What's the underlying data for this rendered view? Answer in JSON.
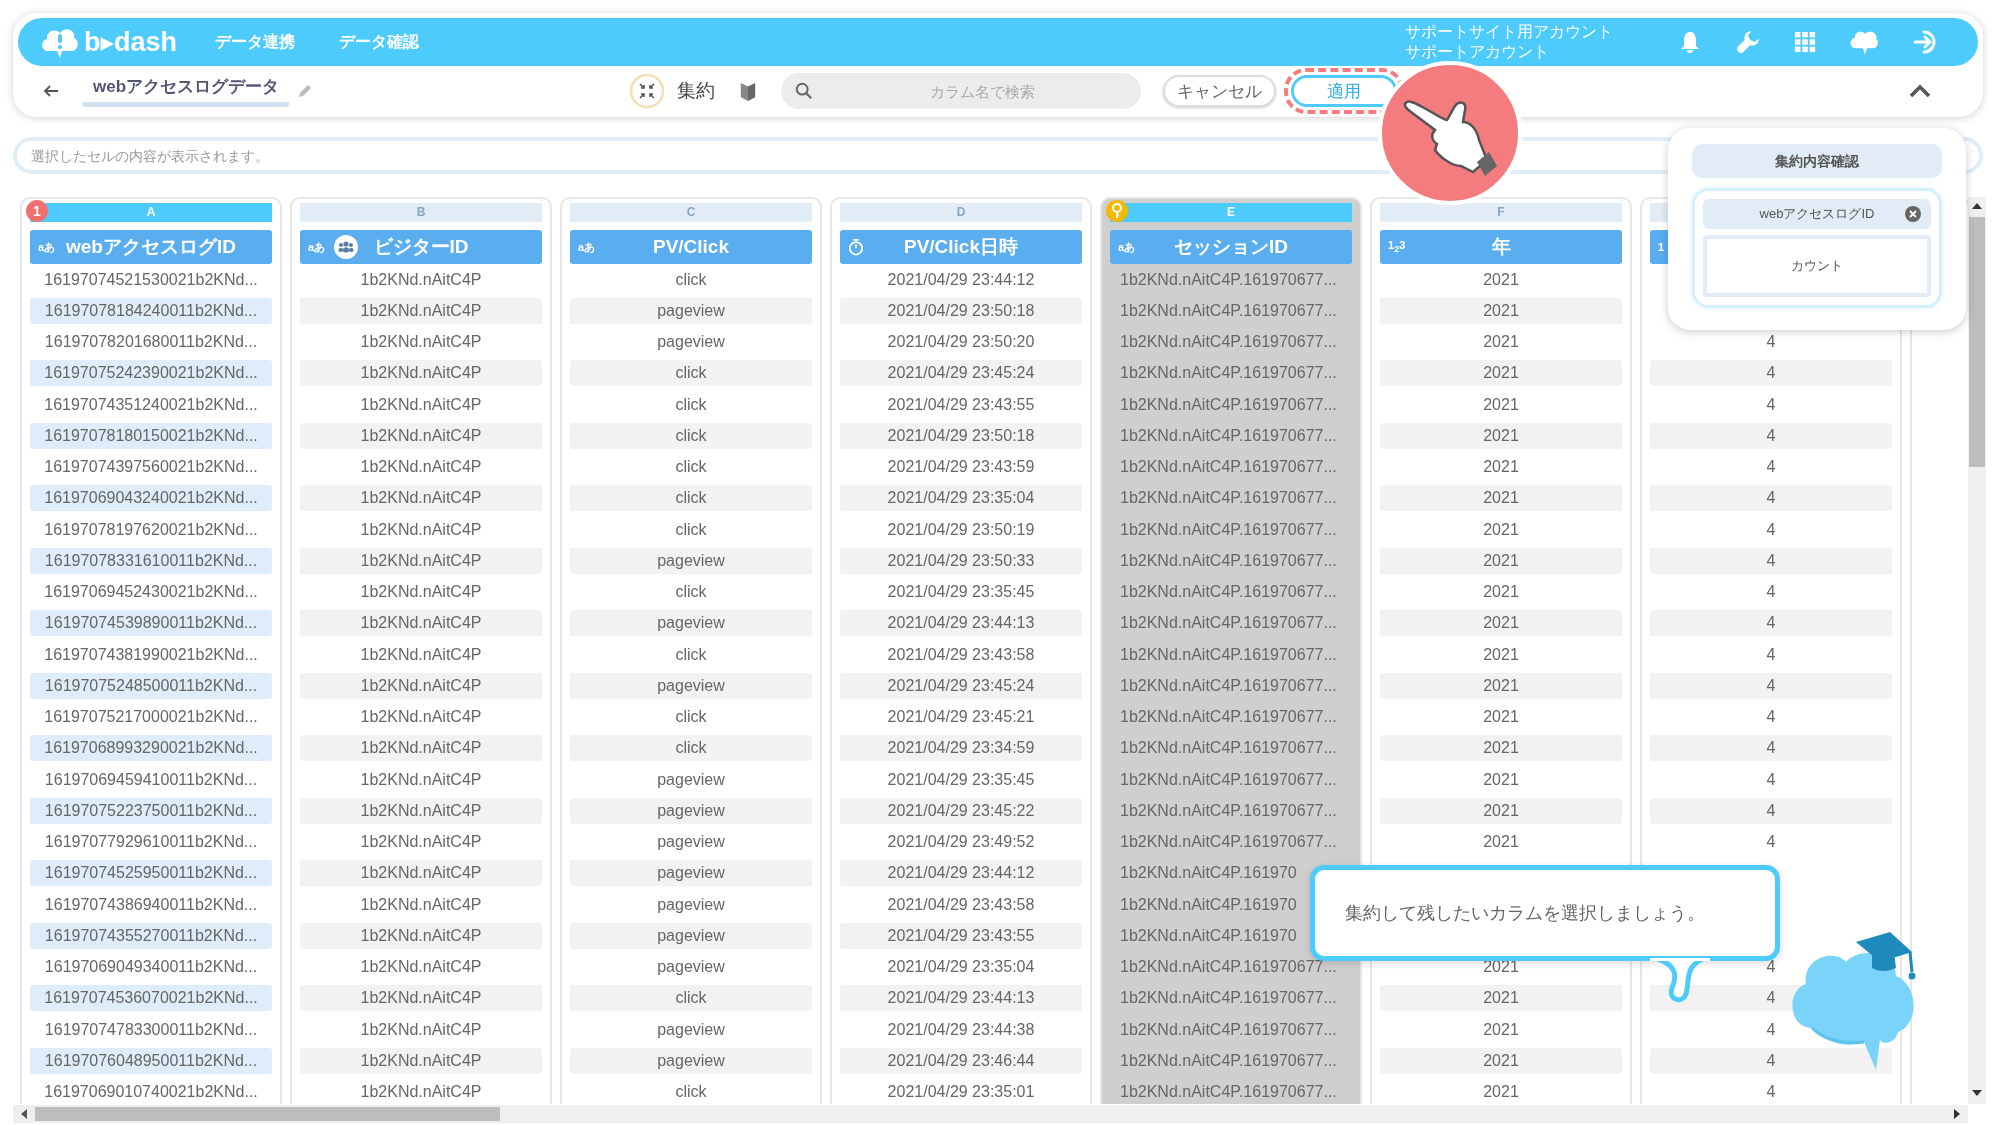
{
  "app": {
    "logo": "b▸dash",
    "nav": [
      {
        "label": "データ連携"
      },
      {
        "label": "データ確認"
      }
    ],
    "account": {
      "site": "サポートサイト用アカウント",
      "name": "サポートアカウント"
    }
  },
  "toolbar": {
    "title": "webアクセスログデータ",
    "mode_label": "集約",
    "search": {
      "placeholder": "カラム名で検索"
    },
    "buttons": [
      {
        "label": "キャンセル",
        "highlighted": false
      },
      {
        "label": "適用",
        "highlighted": true
      }
    ]
  },
  "cell_preview": {
    "placeholder": "選択したセルの内容が表示されます。"
  },
  "columns": [
    {
      "letter": "A",
      "name": "webアクセスログID",
      "kind": "text",
      "type_label": "aあ",
      "visitor": false,
      "selected": true,
      "key": false,
      "badge": "1",
      "cells": [
        "16197074521530021b2KNd...",
        "16197078184240011b2KNd...",
        "16197078201680011b2KNd...",
        "16197075242390021b2KNd...",
        "16197074351240021b2KNd...",
        "16197078180150021b2KNd...",
        "16197074397560021b2KNd...",
        "16197069043240021b2KNd...",
        "16197078197620021b2KNd...",
        "16197078331610011b2KNd...",
        "16197069452430021b2KNd...",
        "16197074539890011b2KNd...",
        "16197074381990021b2KNd...",
        "16197075248500011b2KNd...",
        "16197075217000021b2KNd...",
        "16197068993290021b2KNd...",
        "16197069459410011b2KNd...",
        "16197075223750011b2KNd...",
        "16197077929610011b2KNd...",
        "16197074525950011b2KNd...",
        "16197074386940011b2KNd...",
        "16197074355270011b2KNd...",
        "16197069049340011b2KNd...",
        "16197074536070021b2KNd...",
        "16197074783300011b2KNd...",
        "16197076048950011b2KNd...",
        "16197069010740021b2KNd..."
      ]
    },
    {
      "letter": "B",
      "name": "ビジターID",
      "kind": "text",
      "type_label": "aあ",
      "visitor": true,
      "selected": false,
      "key": false,
      "cells": [
        "1b2KNd.nAitC4P",
        "1b2KNd.nAitC4P",
        "1b2KNd.nAitC4P",
        "1b2KNd.nAitC4P",
        "1b2KNd.nAitC4P",
        "1b2KNd.nAitC4P",
        "1b2KNd.nAitC4P",
        "1b2KNd.nAitC4P",
        "1b2KNd.nAitC4P",
        "1b2KNd.nAitC4P",
        "1b2KNd.nAitC4P",
        "1b2KNd.nAitC4P",
        "1b2KNd.nAitC4P",
        "1b2KNd.nAitC4P",
        "1b2KNd.nAitC4P",
        "1b2KNd.nAitC4P",
        "1b2KNd.nAitC4P",
        "1b2KNd.nAitC4P",
        "1b2KNd.nAitC4P",
        "1b2KNd.nAitC4P",
        "1b2KNd.nAitC4P",
        "1b2KNd.nAitC4P",
        "1b2KNd.nAitC4P",
        "1b2KNd.nAitC4P",
        "1b2KNd.nAitC4P",
        "1b2KNd.nAitC4P",
        "1b2KNd.nAitC4P"
      ]
    },
    {
      "letter": "C",
      "name": "PV/Click",
      "kind": "text",
      "type_label": "aあ",
      "visitor": false,
      "selected": false,
      "key": false,
      "cells": [
        "click",
        "pageview",
        "pageview",
        "click",
        "click",
        "click",
        "click",
        "click",
        "click",
        "pageview",
        "click",
        "pageview",
        "click",
        "pageview",
        "click",
        "click",
        "pageview",
        "pageview",
        "pageview",
        "pageview",
        "pageview",
        "pageview",
        "pageview",
        "click",
        "pageview",
        "pageview",
        "click"
      ]
    },
    {
      "letter": "D",
      "name": "PV/Click日時",
      "kind": "datetime",
      "visitor": false,
      "selected": false,
      "key": false,
      "cells": [
        "2021/04/29 23:44:12",
        "2021/04/29 23:50:18",
        "2021/04/29 23:50:20",
        "2021/04/29 23:45:24",
        "2021/04/29 23:43:55",
        "2021/04/29 23:50:18",
        "2021/04/29 23:43:59",
        "2021/04/29 23:35:04",
        "2021/04/29 23:50:19",
        "2021/04/29 23:50:33",
        "2021/04/29 23:35:45",
        "2021/04/29 23:44:13",
        "2021/04/29 23:43:58",
        "2021/04/29 23:45:24",
        "2021/04/29 23:45:21",
        "2021/04/29 23:34:59",
        "2021/04/29 23:35:45",
        "2021/04/29 23:45:22",
        "2021/04/29 23:49:52",
        "2021/04/29 23:44:12",
        "2021/04/29 23:43:58",
        "2021/04/29 23:43:55",
        "2021/04/29 23:35:04",
        "2021/04/29 23:44:13",
        "2021/04/29 23:44:38",
        "2021/04/29 23:46:44",
        "2021/04/29 23:35:01"
      ]
    },
    {
      "letter": "E",
      "name": "セッションID",
      "kind": "text",
      "type_label": "aあ",
      "visitor": false,
      "selected": true,
      "key": true,
      "cells": [
        "1b2KNd.nAitC4P.161970677...",
        "1b2KNd.nAitC4P.161970677...",
        "1b2KNd.nAitC4P.161970677...",
        "1b2KNd.nAitC4P.161970677...",
        "1b2KNd.nAitC4P.161970677...",
        "1b2KNd.nAitC4P.161970677...",
        "1b2KNd.nAitC4P.161970677...",
        "1b2KNd.nAitC4P.161970677...",
        "1b2KNd.nAitC4P.161970677...",
        "1b2KNd.nAitC4P.161970677...",
        "1b2KNd.nAitC4P.161970677...",
        "1b2KNd.nAitC4P.161970677...",
        "1b2KNd.nAitC4P.161970677...",
        "1b2KNd.nAitC4P.161970677...",
        "1b2KNd.nAitC4P.161970677...",
        "1b2KNd.nAitC4P.161970677...",
        "1b2KNd.nAitC4P.161970677...",
        "1b2KNd.nAitC4P.161970677...",
        "1b2KNd.nAitC4P.161970677...",
        "1b2KNd.nAitC4P.161970",
        "1b2KNd.nAitC4P.161970",
        "1b2KNd.nAitC4P.161970",
        "1b2KNd.nAitC4P.161970677...",
        "1b2KNd.nAitC4P.161970677...",
        "1b2KNd.nAitC4P.161970677...",
        "1b2KNd.nAitC4P.161970677...",
        "1b2KNd.nAitC4P.161970677..."
      ]
    },
    {
      "letter": "F",
      "name": "年",
      "kind": "number",
      "type_label": "1$_{2}$3",
      "visitor": false,
      "selected": false,
      "key": false,
      "cells": [
        "2021",
        "2021",
        "2021",
        "2021",
        "2021",
        "2021",
        "2021",
        "2021",
        "2021",
        "2021",
        "2021",
        "2021",
        "2021",
        "2021",
        "2021",
        "2021",
        "2021",
        "2021",
        "2021",
        null,
        null,
        null,
        "2021",
        "2021",
        "2021",
        "2021",
        "2021"
      ]
    },
    {
      "kind": "number",
      "type_label": "1",
      "selected": false,
      "key": false,
      "cells": [
        null,
        null,
        "4",
        "4",
        "4",
        "4",
        "4",
        "4",
        "4",
        "4",
        "4",
        "4",
        "4",
        "4",
        "4",
        "4",
        "4",
        "4",
        "4",
        null,
        null,
        null,
        "4",
        "4",
        "4",
        "4",
        "4"
      ]
    }
  ],
  "aggregation_panel": {
    "title": "集約内容確認",
    "group_keys": [
      {
        "label": "webアクセスログID"
      }
    ],
    "measure": "カウント"
  },
  "tutorial": {
    "message": "集約して残したいカラムを選択しましょう。"
  }
}
